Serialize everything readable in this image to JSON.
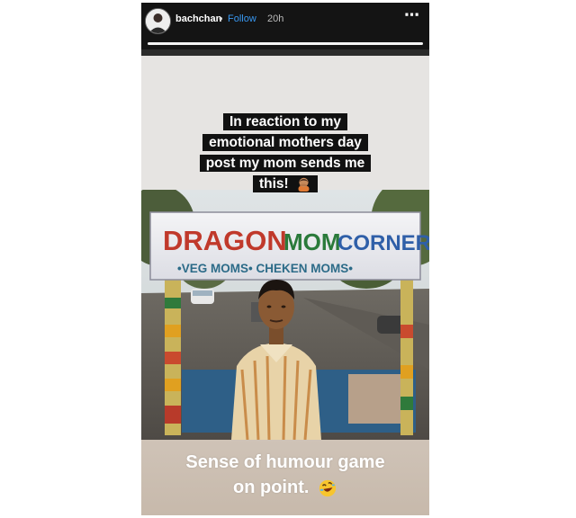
{
  "header": {
    "username": "bachchan",
    "separator": "•",
    "follow_label": "Follow",
    "time": "20h",
    "more_icon": "⋯"
  },
  "story": {
    "caption_lines": [
      "In reaction to my",
      "emotional mothers day",
      "post my mom sends me",
      "this!"
    ],
    "caption_emoji": "person-facepalming-emoji",
    "sign": {
      "title_part1": "DRAGON",
      "title_part2": "MOM",
      "title_part3": "CORNER",
      "subtitle": "•VEG MOMS• CHEKEN MOMS•"
    },
    "bottom_lines": [
      "Sense of humour game",
      "on point."
    ],
    "bottom_emoji": "rolling-on-floor-laughing-emoji"
  },
  "colors": {
    "follow": "#3897f0",
    "header_bg": "#141414"
  }
}
